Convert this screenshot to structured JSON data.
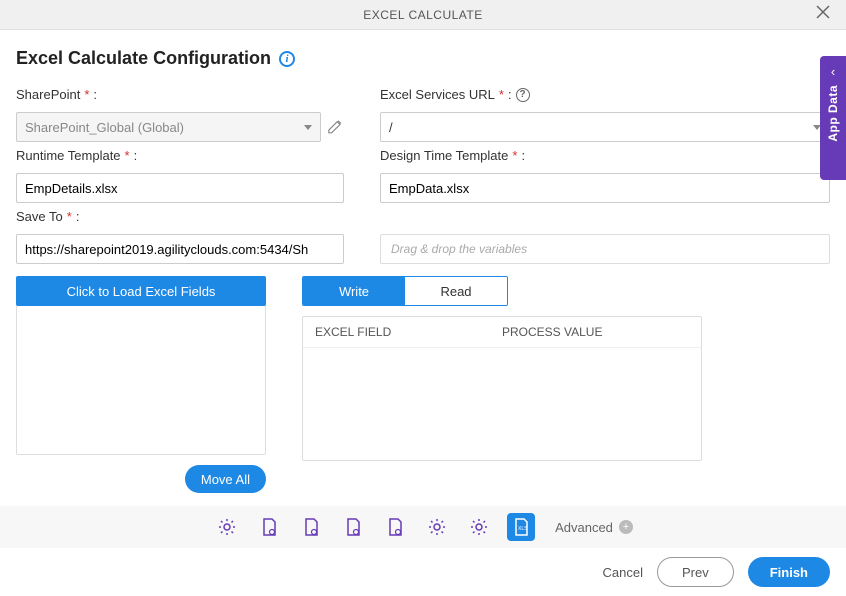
{
  "titlebar": {
    "title": "EXCEL CALCULATE"
  },
  "section": {
    "title": "Excel Calculate Configuration"
  },
  "fields": {
    "sharepoint": {
      "label": "SharePoint",
      "value": "SharePoint_Global (Global)"
    },
    "excel_services_url": {
      "label": "Excel Services URL",
      "value": "/"
    },
    "runtime_template": {
      "label": "Runtime Template",
      "value": "EmpDetails.xlsx"
    },
    "design_template": {
      "label": "Design Time Template",
      "value": "EmpData.xlsx"
    },
    "save_to": {
      "label": "Save To",
      "value": "https://sharepoint2019.agilityclouds.com:5434/Sh"
    },
    "drag_drop": {
      "placeholder": "Drag & drop the variables"
    }
  },
  "buttons": {
    "load_fields": "Click to Load Excel Fields",
    "move_all": "Move All",
    "write": "Write",
    "read": "Read",
    "cancel": "Cancel",
    "prev": "Prev",
    "finish": "Finish",
    "advanced": "Advanced"
  },
  "table": {
    "headers": {
      "excel_field": "EXCEL FIELD",
      "process_value": "PROCESS VALUE"
    }
  },
  "sidebar_tab": {
    "label": "App Data"
  },
  "required_mark": "*",
  "colon": ":"
}
